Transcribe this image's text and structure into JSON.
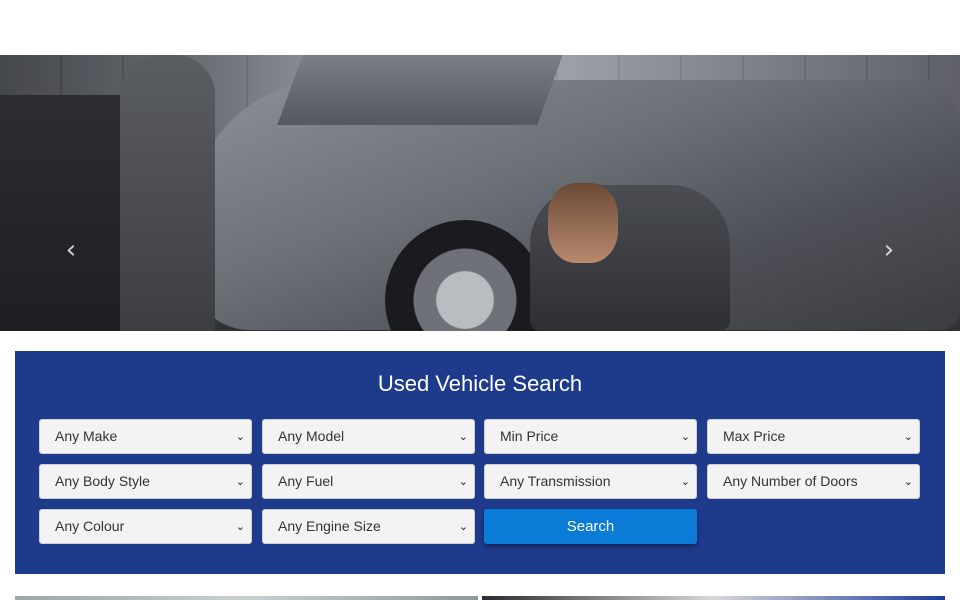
{
  "hero": {
    "prev_arrow": "‹",
    "next_arrow": "›"
  },
  "search": {
    "title": "Used Vehicle Search",
    "fields": [
      "Any Make",
      "Any Model",
      "Min Price",
      "Max Price",
      "Any Body Style",
      "Any Fuel",
      "Any Transmission",
      "Any Number of Doors",
      "Any Colour",
      "Any Engine Size"
    ],
    "button_label": "Search",
    "caret": "⌄"
  },
  "colors": {
    "panel": "#1e3a8a",
    "button": "#0a7bd6"
  }
}
